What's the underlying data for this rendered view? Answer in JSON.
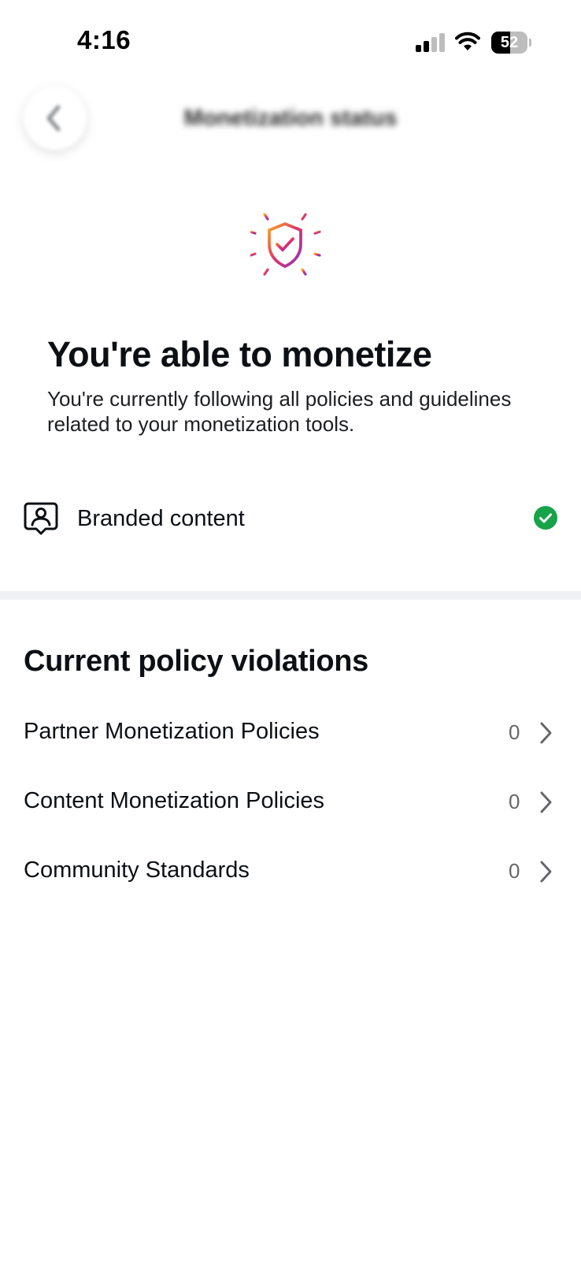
{
  "status_bar": {
    "time": "4:16",
    "battery_level": "52",
    "icons": [
      "cellular-signal-icon",
      "wifi-icon",
      "battery-icon"
    ]
  },
  "header": {
    "title": "Monetization status",
    "back_icon": "chevron-left-icon"
  },
  "hero": {
    "icon": "shield-check-icon",
    "title": "You're able to monetize",
    "description": "You're currently following all policies and guidelines related to your monetization tools."
  },
  "tools": [
    {
      "label": "Branded content",
      "icon": "branded-content-icon",
      "status_icon": "check-circle-icon",
      "status_color": "#17a34a"
    }
  ],
  "violations": {
    "title": "Current policy violations",
    "items": [
      {
        "label": "Partner Monetization Policies",
        "count": "0"
      },
      {
        "label": "Content Monetization Policies",
        "count": "0"
      },
      {
        "label": "Community Standards",
        "count": "0"
      }
    ]
  },
  "colors": {
    "success": "#17a34a",
    "divider": "#eff0f4",
    "text_primary": "#0c1014",
    "text_secondary": "#65676b",
    "gradient": [
      "#f9a825",
      "#e1306c",
      "#8a3ab9"
    ]
  }
}
